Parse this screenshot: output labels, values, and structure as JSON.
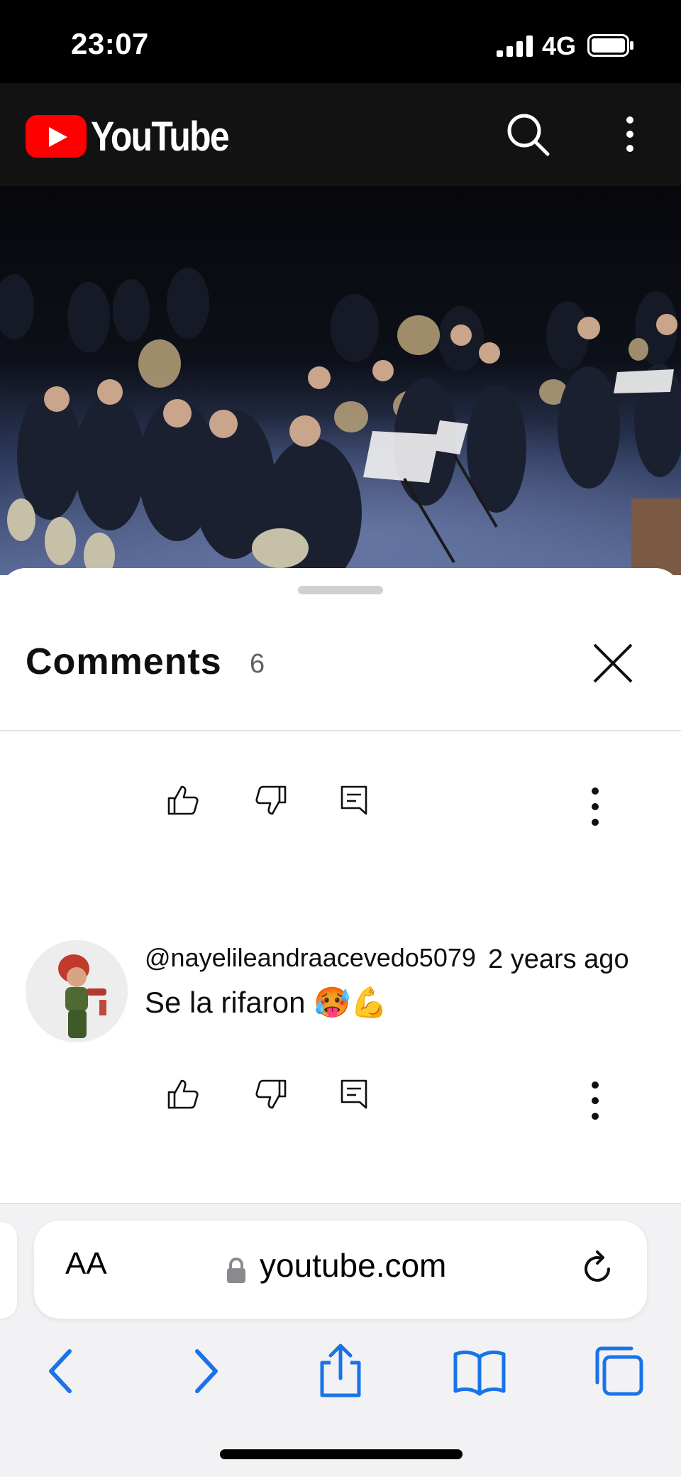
{
  "status_bar": {
    "time": "23:07",
    "network": "4G"
  },
  "header": {
    "logo_text": "YouTube",
    "search_icon": "search-icon",
    "more_icon": "more-vert-icon"
  },
  "comments": {
    "title": "Comments",
    "count": "6",
    "items": [
      {
        "author": "@nayelileandraacevedo5079",
        "time": "2 years ago",
        "text": "Se la rifaron 🥵💪"
      }
    ]
  },
  "safari": {
    "text_size_label": "AA",
    "url": "youtube.com"
  },
  "colors": {
    "youtube_red": "#ff0000",
    "safari_blue": "#1a73e8",
    "header_bg": "#121212"
  }
}
